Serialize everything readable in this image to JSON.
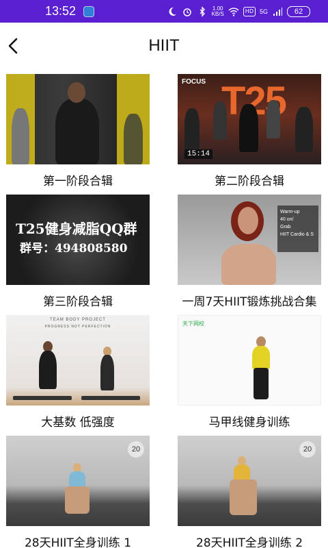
{
  "status_bar": {
    "time": "13:52",
    "network_speed_value": "1.00",
    "network_speed_unit": "KB/S",
    "hd_label": "HD",
    "signal_label": "5G",
    "battery": "62"
  },
  "header": {
    "title": "HIIT"
  },
  "videos": [
    {
      "title": "第一阶段合辑"
    },
    {
      "title": "第二阶段合辑",
      "thumb_text_brand": "FOCUS",
      "thumb_text_big": "T25",
      "thumb_timer": "15:14"
    },
    {
      "title": "第三阶段合辑",
      "thumb_text_line1": "T25健身减脂QQ群",
      "thumb_text_line2": "群号：494808580"
    },
    {
      "title": "一周7天HIIT锻炼挑战合集",
      "thumb_checklist": [
        "Warm-up",
        "40 on/",
        "Grab",
        "HIIT Cardio & S"
      ]
    },
    {
      "title": "大基数 低强度",
      "thumb_text_top": "TEAM BODY PROJECT",
      "thumb_text_sub": "PROGRESS NOT PERFECTION"
    },
    {
      "title": "马甲线健身训练",
      "thumb_brand": "天下网校"
    },
    {
      "title": "28天HIIT全身训练 1",
      "thumb_badge": "20"
    },
    {
      "title": "28天HIIT全身训练 2",
      "thumb_badge": "20"
    }
  ],
  "colors": {
    "status_bar_bg": "#5a1fd1",
    "background": "#ffffff",
    "text": "#111111"
  }
}
